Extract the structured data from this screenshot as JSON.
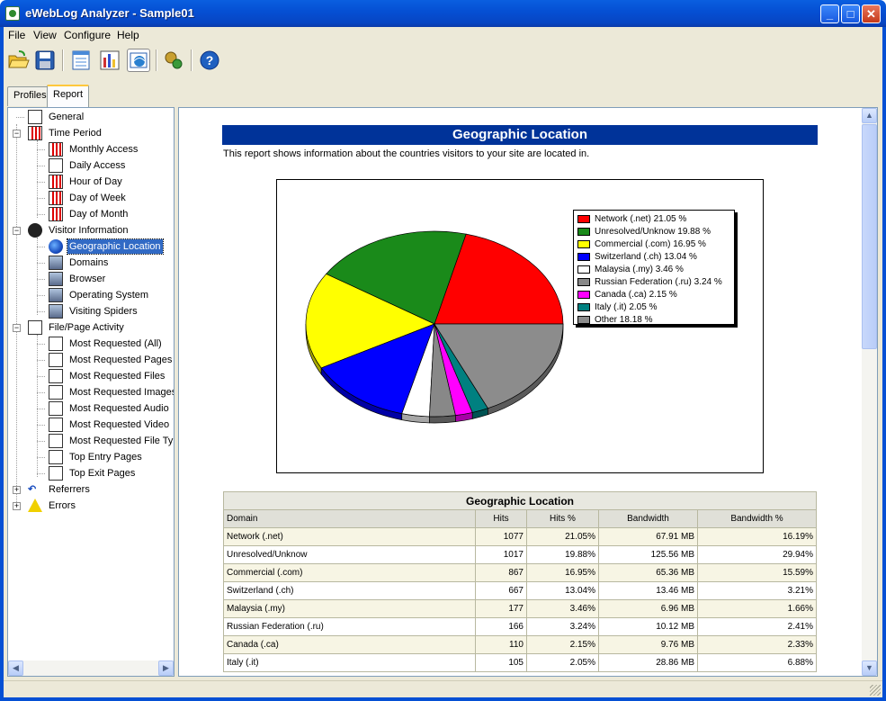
{
  "window": {
    "title": "eWebLog Analyzer - Sample01",
    "min": "_",
    "max": "□",
    "close": "✕"
  },
  "menu": [
    "File",
    "View",
    "Configure",
    "Help"
  ],
  "toolbar": [
    {
      "name": "open-icon",
      "color": "#f0c030"
    },
    {
      "name": "save-icon",
      "color": "#2a5fb0"
    },
    {
      "name": "report-list-icon",
      "color": "#4a8ad8"
    },
    {
      "name": "chart-view-icon",
      "color": "#d03030"
    },
    {
      "name": "browser-view-icon",
      "color": "#2a80d0"
    },
    {
      "name": "process-icon",
      "color": "#c8a030"
    },
    {
      "name": "help-icon",
      "color": "#2060c0"
    }
  ],
  "tabs": {
    "profiles": "Profiles",
    "report": "Report"
  },
  "tree": {
    "general": "General",
    "time_period": "Time Period",
    "monthly": "Monthly Access",
    "daily": "Daily Access",
    "hour": "Hour of Day",
    "dow": "Day of Week",
    "dom": "Day of Month",
    "visitor": "Visitor Information",
    "geo": "Geographic Location",
    "domains": "Domains",
    "browser": "Browser",
    "os": "Operating System",
    "spiders": "Visiting Spiders",
    "filepage": "File/Page Activity",
    "mr_all": "Most Requested (All)",
    "mr_pages": "Most Requested Pages",
    "mr_files": "Most Requested Files",
    "mr_images": "Most Requested Images",
    "mr_audio": "Most Requested Audio",
    "mr_video": "Most Requested Video",
    "mr_filetype": "Most Requested File Typ",
    "entry": "Top Entry Pages",
    "exit": "Top Exit Pages",
    "referrers": "Referrers",
    "errors": "Errors"
  },
  "report": {
    "title": "Geographic Location",
    "description": "This report shows information about the countries visitors to your site are located in."
  },
  "chart_data": {
    "type": "pie",
    "series": [
      {
        "legend": "Network (.net) 21.05 %",
        "value": 21.05,
        "color": "#ff0000"
      },
      {
        "legend": "Unresolved/Unknow 19.88 %",
        "value": 19.88,
        "color": "#1a8a1a"
      },
      {
        "legend": "Commercial (.com) 16.95 %",
        "value": 16.95,
        "color": "#ffff00"
      },
      {
        "legend": "Switzerland (.ch) 13.04 %",
        "value": 13.04,
        "color": "#0000ff"
      },
      {
        "legend": "Malaysia (.my) 3.46 %",
        "value": 3.46,
        "color": "#ffffff"
      },
      {
        "legend": "Russian Federation (.ru) 3.24 %",
        "value": 3.24,
        "color": "#888888"
      },
      {
        "legend": "Canada (.ca) 2.15 %",
        "value": 2.15,
        "color": "#ff00ff"
      },
      {
        "legend": "Italy (.it) 2.05 %",
        "value": 2.05,
        "color": "#008080"
      },
      {
        "legend": "Other 18.18 %",
        "value": 18.18,
        "color": "#8c8c8c"
      }
    ],
    "legend_position": "right"
  },
  "table": {
    "caption": "Geographic Location",
    "headers": [
      "Domain",
      "Hits",
      "Hits %",
      "Bandwidth",
      "Bandwidth %"
    ],
    "rows": [
      [
        "Network (.net)",
        "1077",
        "21.05%",
        "67.91 MB",
        "16.19%"
      ],
      [
        "Unresolved/Unknow",
        "1017",
        "19.88%",
        "125.56 MB",
        "29.94%"
      ],
      [
        "Commercial (.com)",
        "867",
        "16.95%",
        "65.36 MB",
        "15.59%"
      ],
      [
        "Switzerland (.ch)",
        "667",
        "13.04%",
        "13.46 MB",
        "3.21%"
      ],
      [
        "Malaysia (.my)",
        "177",
        "3.46%",
        "6.96 MB",
        "1.66%"
      ],
      [
        "Russian Federation (.ru)",
        "166",
        "3.24%",
        "10.12 MB",
        "2.41%"
      ],
      [
        "Canada (.ca)",
        "110",
        "2.15%",
        "9.76 MB",
        "2.33%"
      ],
      [
        "Italy (.it)",
        "105",
        "2.05%",
        "28.86 MB",
        "6.88%"
      ]
    ]
  }
}
